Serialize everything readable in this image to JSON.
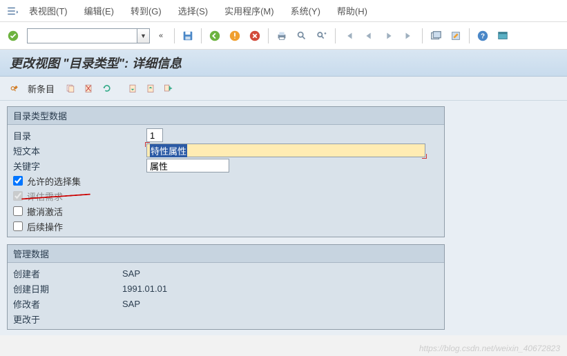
{
  "menu": {
    "items": [
      {
        "label": "表视图(T)",
        "u": "T"
      },
      {
        "label": "编辑(E)",
        "u": "E"
      },
      {
        "label": "转到(G)",
        "u": "G"
      },
      {
        "label": "选择(S)",
        "u": "S"
      },
      {
        "label": "实用程序(M)",
        "u": "M"
      },
      {
        "label": "系统(Y)",
        "u": "Y"
      },
      {
        "label": "帮助(H)",
        "u": "H"
      }
    ]
  },
  "toolbar": {
    "cmd_value": "",
    "dblchev": "«"
  },
  "title": "更改视图 \"目录类型\": 详细信息",
  "appbar": {
    "new_entry": "新条目"
  },
  "group_catalog": {
    "title": "目录类型数据",
    "fields": {
      "catalog_label": "目录",
      "catalog_value": "1",
      "shorttext_label": "短文本",
      "shorttext_value": "特性属性",
      "keyword_label": "关键字",
      "keyword_value": "属性"
    },
    "checkboxes": [
      {
        "label": "允许的选择集",
        "checked": true,
        "disabled": false,
        "redline": false
      },
      {
        "label": "评估需求",
        "checked": true,
        "disabled": true,
        "redline": true
      },
      {
        "label": "撤消激活",
        "checked": false,
        "disabled": false,
        "redline": false
      },
      {
        "label": "后续操作",
        "checked": false,
        "disabled": false,
        "redline": false
      }
    ]
  },
  "group_admin": {
    "title": "管理数据",
    "rows": [
      {
        "label": "创建者",
        "value": "SAP"
      },
      {
        "label": "创建日期",
        "value": "1991.01.01"
      },
      {
        "label": "修改者",
        "value": "SAP"
      },
      {
        "label": "更改于",
        "value": ""
      }
    ]
  },
  "watermark": "https://blog.csdn.net/weixin_40672823"
}
